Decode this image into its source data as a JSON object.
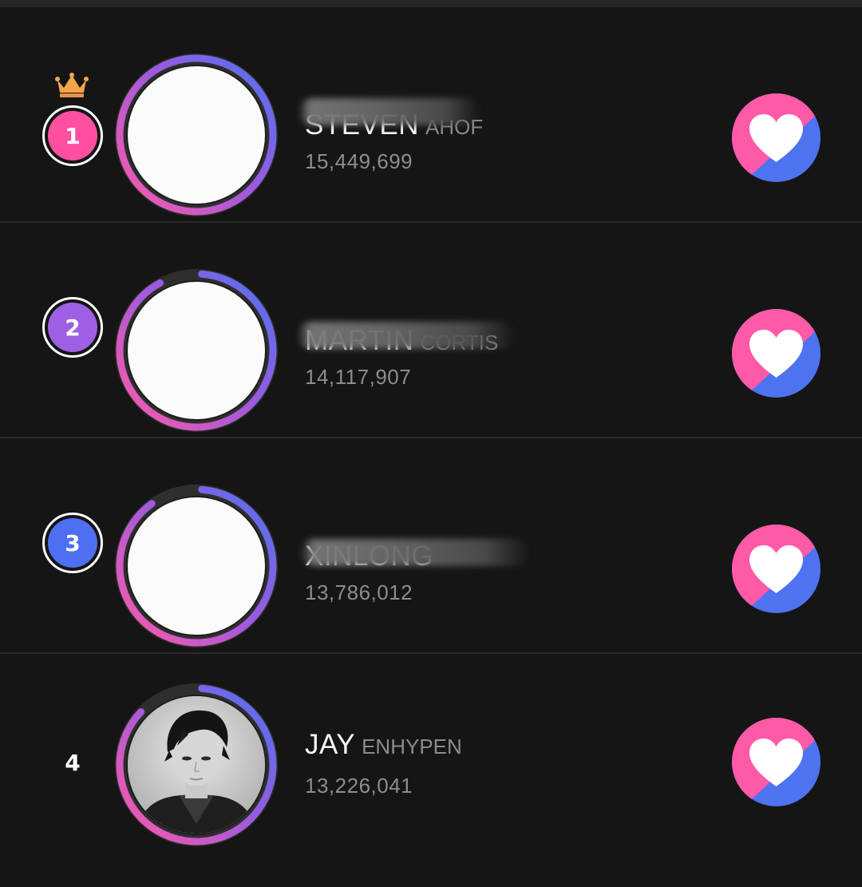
{
  "colors": {
    "background": "#151515",
    "pink": "#ff5aa8",
    "purple": "#9a5ae0",
    "blue": "#4d73f0",
    "gold": "#f2a64a",
    "ring_track": "#2e2e2e"
  },
  "ranking": [
    {
      "rank": "1",
      "badge_color": "#ff4fa0",
      "crown": true,
      "name": "STEVEN",
      "group": "AHOF",
      "votes": "15,449,699",
      "name_obscured": true,
      "progress": 1.0,
      "has_photo": false,
      "icon": "heart-vote-icon"
    },
    {
      "rank": "2",
      "badge_color": "#9f5fe4",
      "crown": false,
      "name": "MARTIN",
      "group": "CORTIS",
      "votes": "14,117,907",
      "name_obscured": true,
      "progress": 0.91,
      "has_photo": false,
      "icon": "heart-vote-icon"
    },
    {
      "rank": "3",
      "badge_color": "#4f6ff2",
      "crown": false,
      "name": "XINLONG",
      "group": "",
      "votes": "13,786,012",
      "name_obscured": true,
      "progress": 0.89,
      "has_photo": false,
      "icon": "heart-vote-icon"
    },
    {
      "rank": "4",
      "badge_color": "",
      "crown": false,
      "name": "JAY",
      "group": "ENHYPEN",
      "votes": "13,226,041",
      "name_obscured": false,
      "progress": 0.86,
      "has_photo": true,
      "icon": "heart-vote-icon"
    }
  ]
}
